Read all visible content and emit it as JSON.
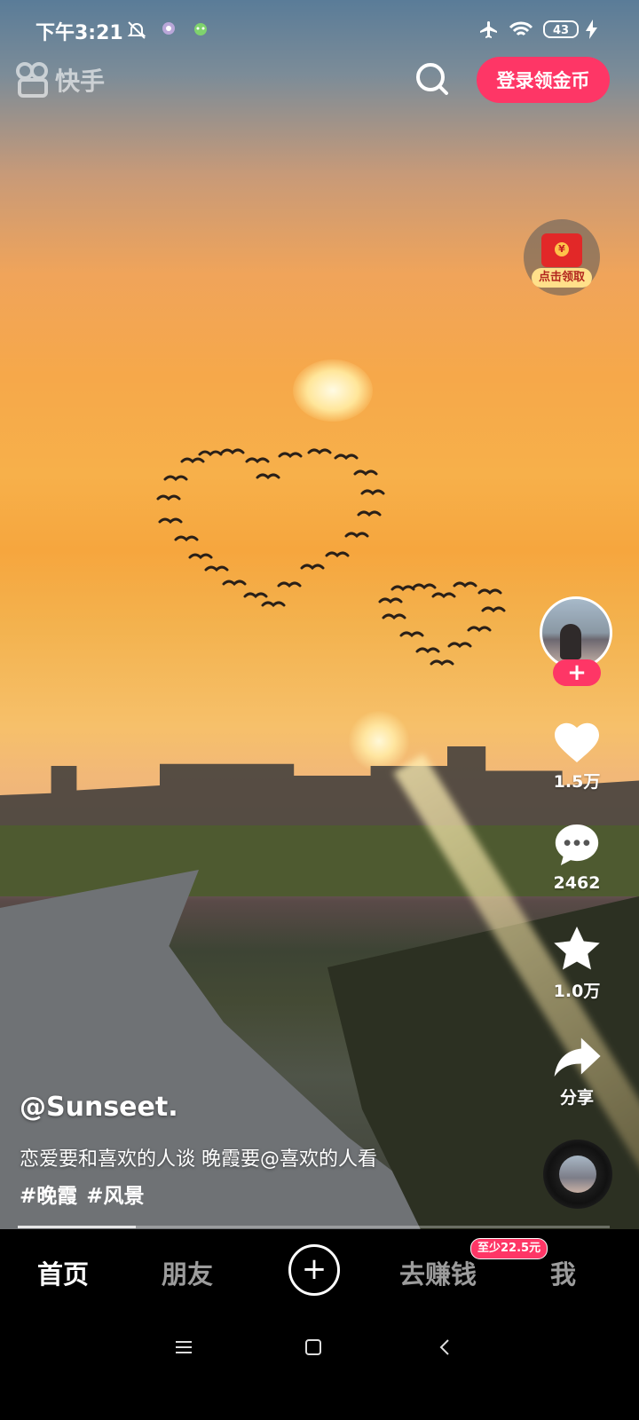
{
  "status_bar": {
    "time": "下午3:21",
    "battery": "43",
    "icons": [
      "mute-icon",
      "app-notification-icon",
      "app-notification-icon",
      "airplane-icon",
      "wifi-icon",
      "battery-icon",
      "charging-icon"
    ]
  },
  "header": {
    "logo_text": "快手",
    "login_button": "登录领金币",
    "red_packet_label": "点击领取"
  },
  "video": {
    "author": "@Sunseet.",
    "caption": "恋爱要和喜欢的人谈 晚霞要@喜欢的人看",
    "hashtags": [
      "#晚霞",
      "#风景"
    ],
    "progress": 0.2
  },
  "actions": {
    "follow": "+",
    "likes": "1.5万",
    "comments": "2462",
    "favorites": "1.0万",
    "share": "分享"
  },
  "bottom_nav": {
    "tabs": [
      "首页",
      "朋友",
      "去赚钱",
      "我"
    ],
    "create": "+",
    "earn_badge": "至少22.5元"
  },
  "system_nav": [
    "menu-icon",
    "home-icon",
    "back-icon"
  ],
  "colors": {
    "accent": "#fe3666",
    "nav_bg": "#000000",
    "inactive_tab": "#9c9c9c"
  }
}
